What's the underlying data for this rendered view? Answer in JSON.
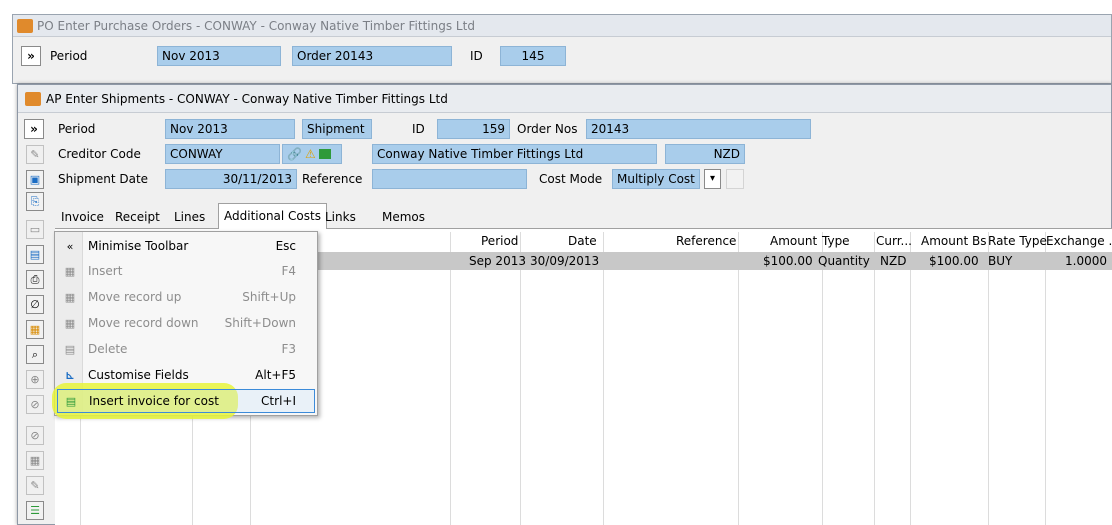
{
  "po_window": {
    "title": "PO Enter Purchase Orders - CONWAY - Conway Native Timber Fittings Ltd",
    "period_label": "Period",
    "period_value": "Nov 2013",
    "order_value": "Order 20143",
    "id_label": "ID",
    "id_value": "145"
  },
  "ap_window": {
    "title": "AP Enter Shipments - CONWAY - Conway Native Timber Fittings Ltd",
    "period_label": "Period",
    "period_value": "Nov 2013",
    "shipment_value": "Shipment",
    "id_label": "ID",
    "id_value": "159",
    "order_nos_label": "Order Nos",
    "order_nos_value": "20143",
    "creditor_code_label": "Creditor Code",
    "creditor_code_value": "CONWAY",
    "creditor_name": "Conway Native Timber Fittings Ltd",
    "currency": "NZD",
    "shipment_date_label": "Shipment Date",
    "shipment_date_value": "30/11/2013",
    "reference_label": "Reference",
    "reference_value": "",
    "cost_mode_label": "Cost Mode",
    "cost_mode_value": "Multiply Cost"
  },
  "tabs": [
    "Invoice",
    "Receipt",
    "Lines",
    "Additional Costs",
    "Links",
    "Memos"
  ],
  "active_tab": "Additional Costs",
  "grid": {
    "headers": {
      "period": "Period",
      "date": "Date",
      "reference": "Reference",
      "amount": "Amount",
      "type": "Type",
      "curr": "Curr...",
      "amount_bs": "Amount Bs",
      "rate_type": "Rate Type",
      "exchange": "Exchange ..."
    },
    "row": {
      "period": "Sep 2013",
      "date": "30/09/2013",
      "reference": "",
      "amount": "$100.00",
      "type": "Quantity",
      "curr": "NZD",
      "amount_bs": "$100.00",
      "rate_type": "BUY",
      "exchange": "1.0000"
    }
  },
  "context_menu": {
    "items": [
      {
        "label": "Minimise Toolbar",
        "shortcut": "Esc",
        "enabled": true,
        "icon": "double-chevron-left-icon"
      },
      {
        "label": "Insert",
        "shortcut": "F4",
        "enabled": false,
        "icon": "insert-icon"
      },
      {
        "label": "Move record up",
        "shortcut": "Shift+Up",
        "enabled": false,
        "icon": "move-up-icon"
      },
      {
        "label": "Move record down",
        "shortcut": "Shift+Down",
        "enabled": false,
        "icon": "move-down-icon"
      },
      {
        "label": "Delete",
        "shortcut": "F3",
        "enabled": false,
        "icon": "delete-icon"
      },
      {
        "label": "Customise Fields",
        "shortcut": "Alt+F5",
        "enabled": true,
        "icon": "customise-icon"
      },
      {
        "label": "Insert invoice for cost",
        "shortcut": "Ctrl+I",
        "enabled": true,
        "icon": "invoice-icon"
      }
    ]
  },
  "colors": {
    "field_bg": "#a9cdeb",
    "highlight": "#e8f53a",
    "title_bar": "#e9ecf0",
    "selected_row": "#c8c8c8"
  },
  "icons": {
    "expand": "»",
    "chevron": "«"
  }
}
